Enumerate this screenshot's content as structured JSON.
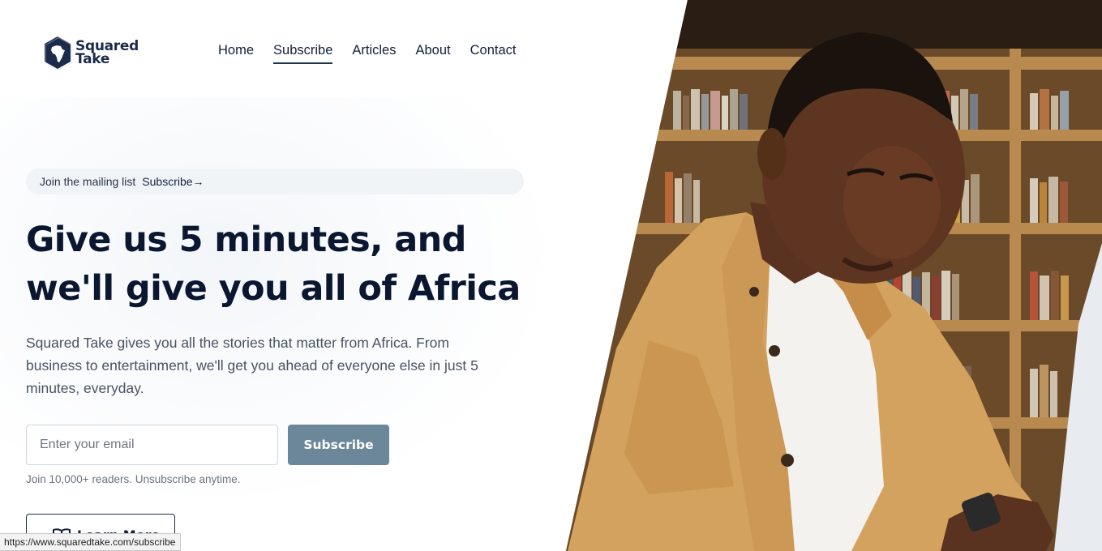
{
  "brand": {
    "name_line1": "Squared",
    "name_line2": "Take"
  },
  "nav": {
    "items": [
      {
        "label": "Home"
      },
      {
        "label": "Subscribe",
        "active": true
      },
      {
        "label": "Articles"
      },
      {
        "label": "About"
      },
      {
        "label": "Contact"
      }
    ]
  },
  "banner": {
    "text": "Join the mailing list",
    "link": "Subscribe→"
  },
  "hero": {
    "title_line1": "Give us 5 minutes, and",
    "title_line2": "we'll give you all of Africa",
    "description": "Squared Take gives you all the stories that matter from Africa. From business to entertainment, we'll get you ahead of everyone else in just 5 minutes, everyday."
  },
  "signup": {
    "email_placeholder": "Enter your email",
    "button_label": "Subscribe",
    "note": "Join 10,000+ readers. Unsubscribe anytime."
  },
  "learn_more": {
    "label": "Learn More",
    "icon": "book-open-icon"
  },
  "status_bar": {
    "url": "https://www.squaredtake.com/subscribe"
  },
  "colors": {
    "primary_dark": "#0b1630",
    "subscribe_button": "#6b8799",
    "banner_bg": "#f1f4f7",
    "logo": "#1c2b4a"
  }
}
